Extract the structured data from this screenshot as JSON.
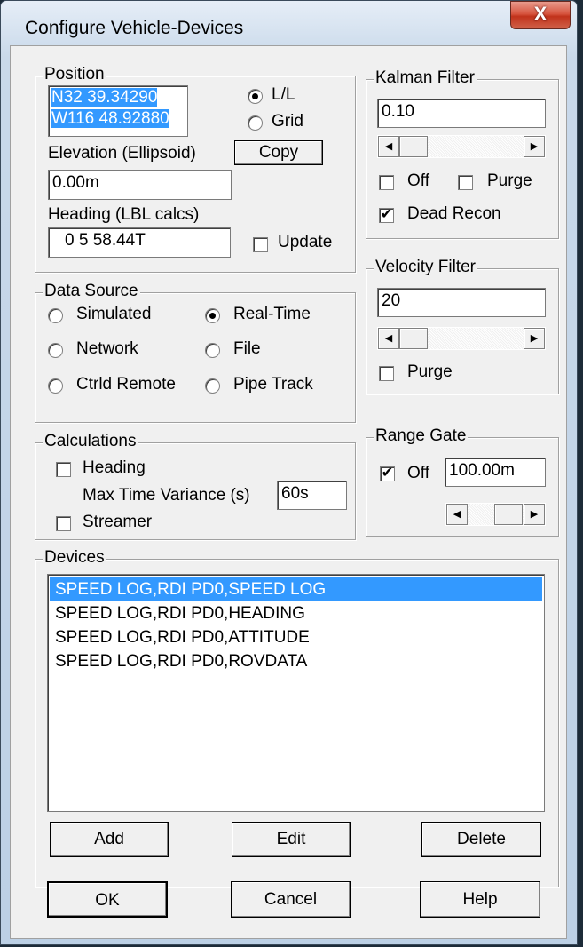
{
  "window": {
    "title": "Configure Vehicle-Devices",
    "close_label": "X"
  },
  "position": {
    "legend": "Position",
    "lat": "N32 39.34290",
    "lon": "W116 48.92880",
    "mode_ll": "L/L",
    "mode_grid": "Grid",
    "mode_selected": "L/L",
    "copy_label": "Copy",
    "elevation_label": "Elevation (Ellipsoid)",
    "elevation_value": "0.00m",
    "heading_label": "Heading (LBL calcs)",
    "heading_value": "0  5 58.44T",
    "update_label": "Update",
    "update_checked": false
  },
  "kalman": {
    "legend": "Kalman Filter",
    "value": "0.10",
    "off_label": "Off",
    "off_checked": false,
    "purge_label": "Purge",
    "purge_checked": false,
    "dead_recon_label": "Dead Recon",
    "dead_recon_checked": true
  },
  "velocity": {
    "legend": "Velocity Filter",
    "value": "20",
    "purge_label": "Purge",
    "purge_checked": false
  },
  "data_source": {
    "legend": "Data Source",
    "options": [
      "Simulated",
      "Real-Time",
      "Network",
      "File",
      "Ctrld Remote",
      "Pipe Track"
    ],
    "selected": "Real-Time"
  },
  "calculations": {
    "legend": "Calculations",
    "heading_label": "Heading",
    "heading_checked": false,
    "max_time_label": "Max Time Variance (s)",
    "max_time_value": "60s",
    "streamer_label": "Streamer",
    "streamer_checked": false
  },
  "range_gate": {
    "legend": "Range Gate",
    "off_label": "Off",
    "off_checked": true,
    "value": "100.00m"
  },
  "devices": {
    "legend": "Devices",
    "items": [
      "SPEED LOG,RDI PD0,SPEED LOG",
      "SPEED LOG,RDI PD0,HEADING",
      "SPEED LOG,RDI PD0,ATTITUDE",
      "SPEED LOG,RDI PD0,ROVDATA"
    ],
    "selected_index": 0,
    "add_label": "Add",
    "edit_label": "Edit",
    "delete_label": "Delete"
  },
  "footer": {
    "ok_label": "OK",
    "cancel_label": "Cancel",
    "help_label": "Help"
  },
  "colors": {
    "selection": "#3399ff",
    "close_button": "#c1321b"
  }
}
